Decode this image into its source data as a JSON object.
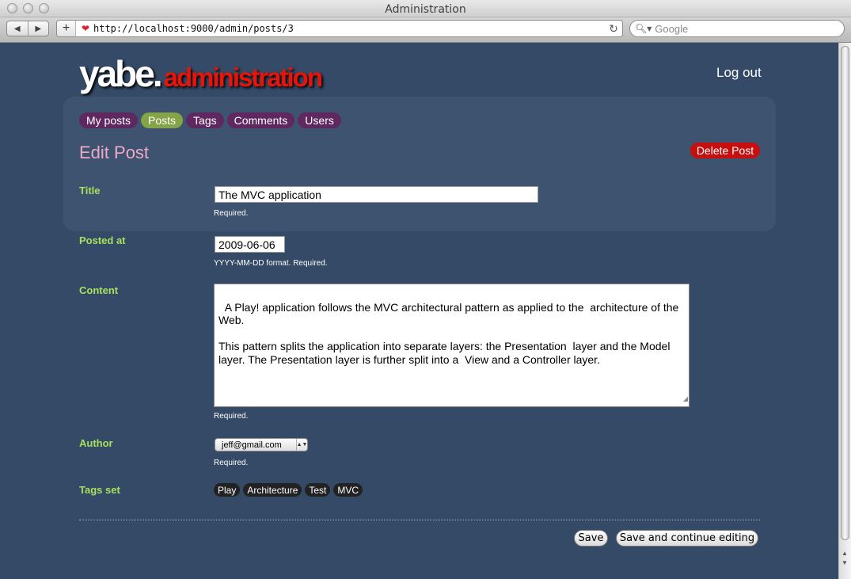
{
  "window": {
    "title": "Administration"
  },
  "browser": {
    "url": "http://localhost:9000/admin/posts/3",
    "search_placeholder": "Google"
  },
  "header": {
    "logo": "yabe.",
    "logo_sub": "administration",
    "logout": "Log out"
  },
  "nav": {
    "tabs": [
      {
        "label": "My posts"
      },
      {
        "label": "Posts",
        "active": true
      },
      {
        "label": "Tags"
      },
      {
        "label": "Comments"
      },
      {
        "label": "Users"
      }
    ]
  },
  "page": {
    "title": "Edit Post",
    "delete_label": "Delete Post"
  },
  "form": {
    "title": {
      "label": "Title",
      "value": "The MVC application",
      "hint": "Required."
    },
    "posted_at": {
      "label": "Posted at",
      "value": "2009-06-06",
      "hint": "YYYY-MM-DD format. Required."
    },
    "content": {
      "label": "Content",
      "value": "A Play! application follows the MVC architectural pattern as applied to the  architecture of the Web.\n\nThis pattern splits the application into separate layers: the Presentation  layer and the Model layer. The Presentation layer is further split into a  View and a Controller layer.",
      "hint": "Required."
    },
    "author": {
      "label": "Author",
      "value": "jeff@gmail.com",
      "hint": "Required."
    },
    "tags": {
      "label": "Tags set",
      "items": [
        "Play",
        "Architecture",
        "Test",
        "MVC"
      ]
    }
  },
  "actions": {
    "save": "Save",
    "save_continue": "Save and continue editing"
  },
  "colors": {
    "background": "#354a66",
    "label_green": "#a6e05c",
    "tab_purple": "#5f2860",
    "tab_active": "#85a347",
    "delete_red": "#c70f0f",
    "title_pink": "#f0a8c8"
  }
}
